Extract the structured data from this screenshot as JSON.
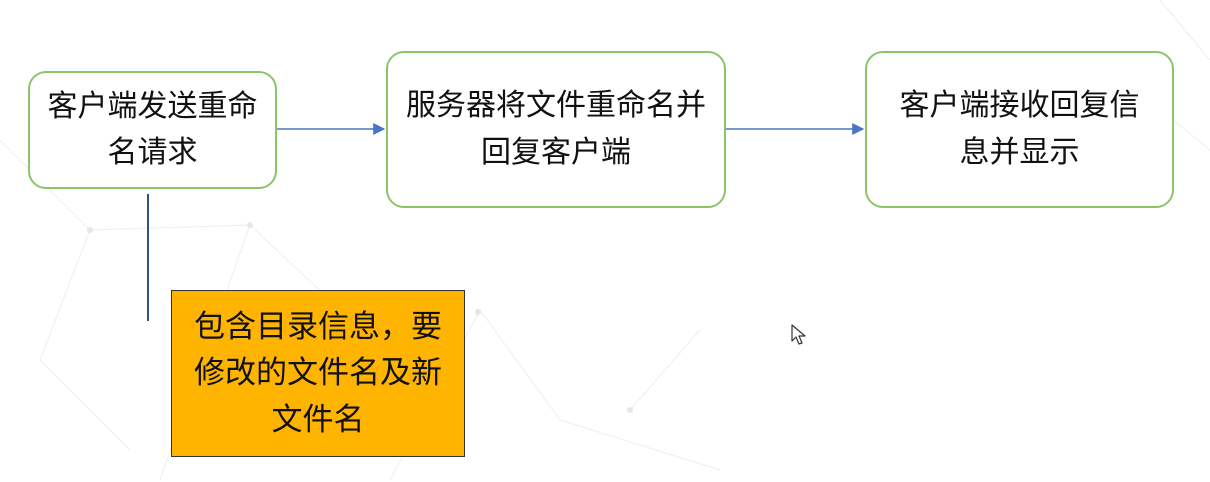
{
  "diagram": {
    "nodes": [
      {
        "id": "client-send",
        "text": "客户端发送重命名请求"
      },
      {
        "id": "server-rename",
        "text": "服务器将文件重命名并回复客户端"
      },
      {
        "id": "client-receive",
        "text": "客户端接收回复信息并显示"
      }
    ],
    "note": {
      "text": "包含目录信息，要修改的文件名及新文件名"
    },
    "edges": [
      {
        "from": "client-send",
        "to": "server-rename"
      },
      {
        "from": "server-rename",
        "to": "client-receive"
      }
    ],
    "colors": {
      "node_border": "#8cc46a",
      "arrow": "#4a74c4",
      "note_fill": "#ffb400",
      "connector": "#34508a"
    }
  }
}
